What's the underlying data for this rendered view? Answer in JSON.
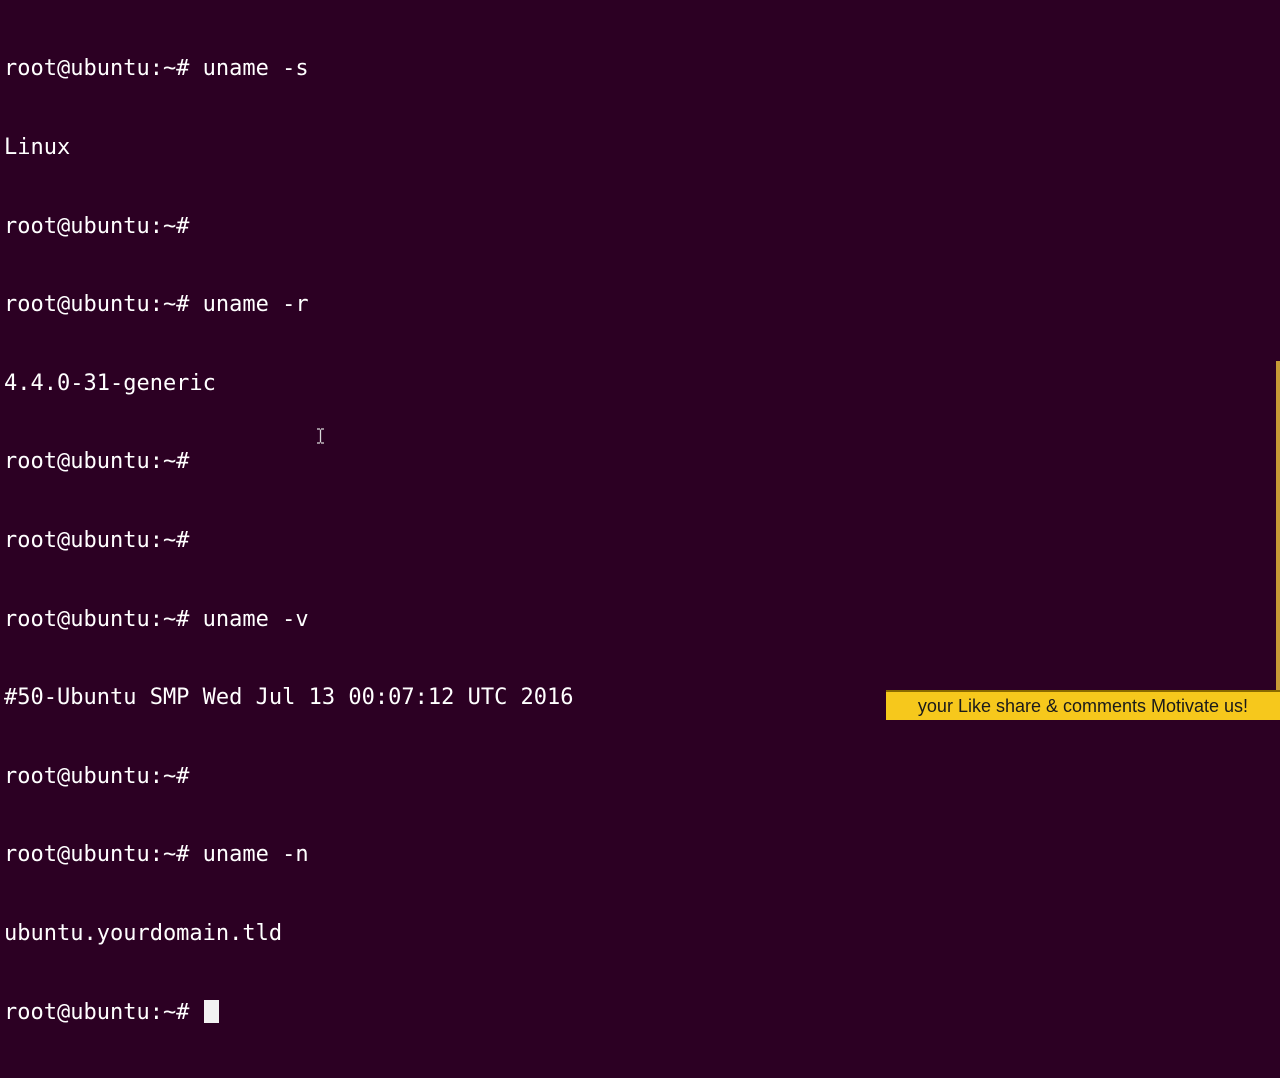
{
  "terminal": {
    "prompt": "root@ubuntu:~#",
    "lines": [
      "root@ubuntu:~# uname -s",
      "Linux",
      "root@ubuntu:~#",
      "root@ubuntu:~# uname -r",
      "4.4.0-31-generic",
      "root@ubuntu:~#",
      "root@ubuntu:~#",
      "root@ubuntu:~# uname -v",
      "#50-Ubuntu SMP Wed Jul 13 00:07:12 UTC 2016",
      "root@ubuntu:~#",
      "root@ubuntu:~# uname -n",
      "ubuntu.yourdomain.tld",
      "root@ubuntu:~# "
    ],
    "colors": {
      "background": "#2c0023",
      "foreground": "#ffffff",
      "cursor": "#f2f2f2",
      "scrollbar": "#c79a36"
    }
  },
  "overlay": {
    "banner_text": "your Like share & comments Motivate us!",
    "banner_color": "#f6c81c"
  },
  "icons": {
    "mouse_cursor": "text-ibeam-icon"
  }
}
